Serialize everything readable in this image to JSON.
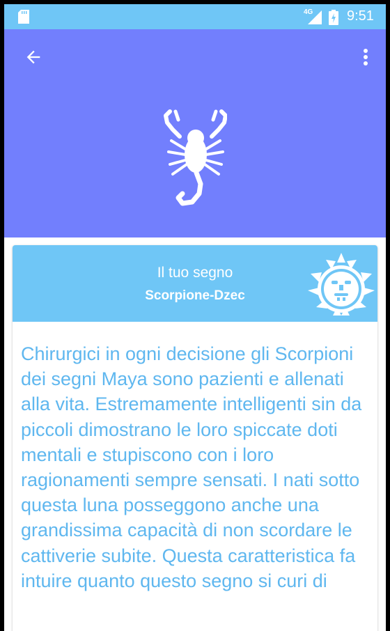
{
  "status_bar": {
    "network_label": "4G",
    "time": "9:51"
  },
  "app_bar": {
    "back_icon": "arrow-back-icon",
    "menu_icon": "more-vert-icon",
    "sign_icon": "scorpion-icon"
  },
  "card": {
    "label": "Il tuo segno",
    "sign_name": "Scorpione-Dzec",
    "glyph_icon": "maya-glyph-icon",
    "description": "Chirurgici in ogni decisione gli Scorpioni dei segni Maya sono pazienti e allenati alla vita. Estremamente intelligenti sin da piccoli dimostrano le loro spiccate doti mentali e stupiscono con i loro ragionamenti sempre sensati. I nati sotto questa luna posseggono anche una grandissima capacità di non scordare le cattiverie subite. Questa caratteristica fa intuire quanto questo segno si curi di"
  },
  "colors": {
    "status_bar": "#6fc6f6",
    "app_bar": "#727ffd",
    "card_header": "#6fc6f6",
    "text_accent": "#5fb7ef"
  }
}
